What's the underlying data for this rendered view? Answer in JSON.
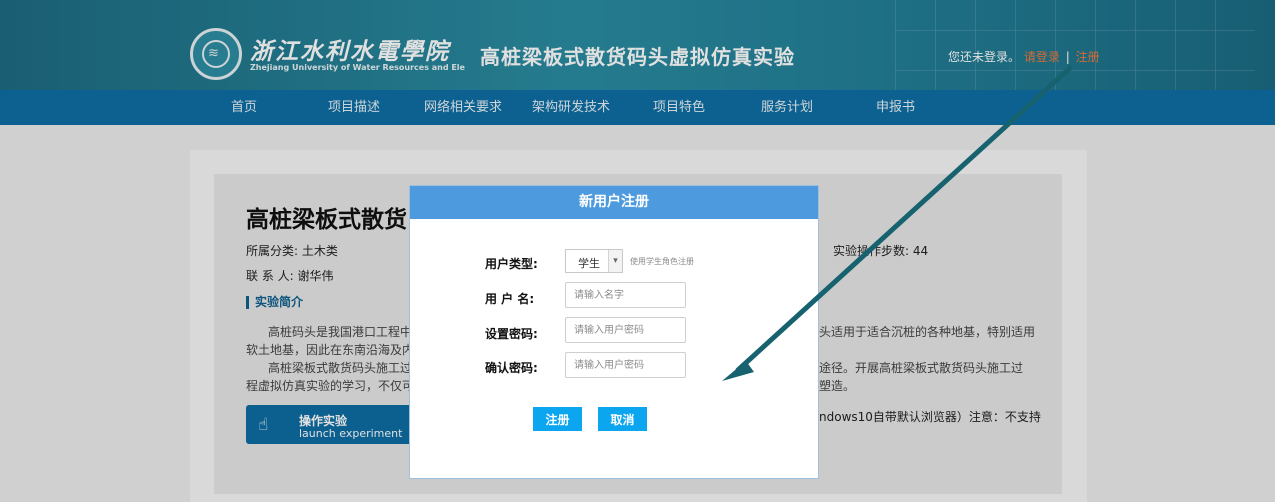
{
  "header": {
    "school_name_cn": "浙江水利水電學院",
    "school_name_en": "Zhejiang University of Water Resources and Electric Power",
    "site_title": "高桩梁板式散货码头虚拟仿真实验",
    "login_prompt": "您还未登录。",
    "login_link": "请登录",
    "separator": "|",
    "register_link": "注册"
  },
  "nav": {
    "items": [
      {
        "label": "首页"
      },
      {
        "label": "项目描述"
      },
      {
        "label": "网络相关要求"
      },
      {
        "label": "架构研发技术"
      },
      {
        "label": "项目特色"
      },
      {
        "label": "服务计划"
      },
      {
        "label": "申报书"
      }
    ]
  },
  "experiment": {
    "title": "高桩梁板式散货",
    "category": "所属分类: 土木类",
    "contact": "联 系 人:   谢华伟",
    "steps": "实验操作步数:   44",
    "intro_heading": "实验简介",
    "para1_a": "高桩码头是我国港口工程中最",
    "para1_b": "头适用于适合沉桩的各种地基，特别适用",
    "para1_c": "软土地基，因此在东南沿海及内河",
    "para2_a": "高桩梁板式散货码头施工过程",
    "para2_b": "途径。开展高桩梁板式散货码头施工过",
    "para2_c": "程虚拟仿真实验的学习，不仅可以",
    "para2_d": "塑造。",
    "browser_note": "ndows10自带默认浏览器）注意：不支持",
    "launch_cn": "操作实验",
    "launch_en": "launch experiment"
  },
  "modal": {
    "title": "新用户注册",
    "user_type_label": "用户类型:",
    "user_type_value": "学生",
    "user_type_hint": "使用学生角色注册",
    "username_label": "用 户 名:",
    "username_placeholder": "请输入名字",
    "password_label": "设置密码:",
    "password_placeholder": "请输入用户密码",
    "confirm_label": "确认密码:",
    "confirm_placeholder": "请输入用户密码",
    "register_button": "注册",
    "cancel_button": "取消"
  },
  "colors": {
    "header_bg": "#2a8da2",
    "nav_bg": "#0f6fa4",
    "modal_header": "#4d9bde",
    "button": "#0ba5f0",
    "link": "#f27a3c",
    "annotation_arrow": "#17626f"
  },
  "icons": {
    "logo": "school-seal-icon",
    "select_arrow": "chevron-down-icon",
    "launch": "hand-pointer-icon"
  }
}
